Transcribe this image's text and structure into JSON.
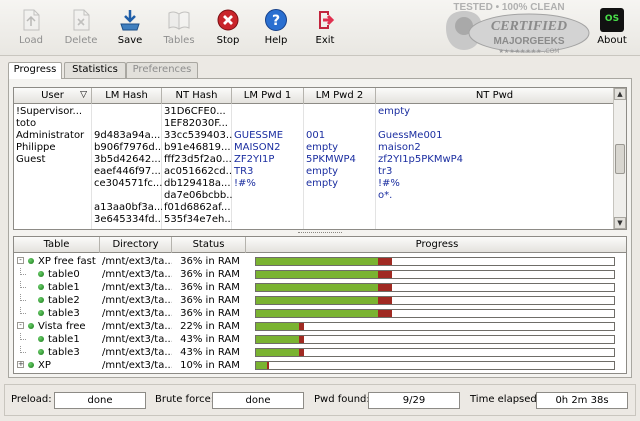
{
  "toolbar": {
    "load": "Load",
    "delete": "Delete",
    "save": "Save",
    "tables": "Tables",
    "stop": "Stop",
    "help": "Help",
    "exit": "Exit",
    "about": "About",
    "about_badge": "OS"
  },
  "watermark": {
    "top": "TESTED • 100% CLEAN",
    "middle": "CERTIFIED",
    "bottom": "MAJORGEEKS",
    "stars": "★★★★★★★★ .COM"
  },
  "tabs": [
    "Progress",
    "Statistics",
    "Preferences"
  ],
  "hash_table": {
    "columns": [
      "User",
      "LM Hash",
      "NT Hash",
      "LM Pwd 1",
      "LM Pwd 2",
      "NT Pwd"
    ],
    "sort_indicator": "▽",
    "rows": [
      [
        "!Supervisor...",
        "",
        "31D6CFE0...",
        "",
        "",
        "empty"
      ],
      [
        "toto",
        "",
        "1EF82030F...",
        "",
        "",
        ""
      ],
      [
        "Administrator",
        "9d483a94a...",
        "33cc539403...",
        "GUESSME",
        "001",
        "GuessMe001"
      ],
      [
        "Philippe",
        "b906f7976d...",
        "b91e46819...",
        "MAISON2",
        "empty",
        "maison2"
      ],
      [
        "Guest",
        "3b5d42642...",
        "fff23d5f2a0...",
        "ZF2YI1P",
        "5PKMWP4",
        "zf2YI1p5PKMwP4"
      ],
      [
        "",
        "eaef446f97...",
        "ac051662cd...",
        "TR3",
        "empty",
        "tr3"
      ],
      [
        "",
        "ce304571fc...",
        "db129418a...",
        "!#%",
        "empty",
        "!#%"
      ],
      [
        "",
        "",
        "da7e06bcbb...",
        "",
        "",
        "o*."
      ],
      [
        "",
        "a13aa0bf3a...",
        "f01d6862af...",
        "",
        "",
        ""
      ],
      [
        "",
        "3e645334fd...",
        "535f34e7eh...",
        "",
        "",
        ""
      ]
    ]
  },
  "table_list": {
    "columns": [
      "Table",
      "Directory",
      "Status",
      "Progress"
    ],
    "rows": [
      {
        "name": "XP free fast",
        "dir": "/mnt/ext3/ta...",
        "status": "36% in RAM",
        "level": 0,
        "expander": "-",
        "progress": 0.34,
        "tip": 0.04
      },
      {
        "name": "table0",
        "dir": "/mnt/ext3/ta...",
        "status": "36% in RAM",
        "level": 1,
        "expander": "",
        "progress": 0.34,
        "tip": 0.04
      },
      {
        "name": "table1",
        "dir": "/mnt/ext3/ta...",
        "status": "36% in RAM",
        "level": 1,
        "expander": "",
        "progress": 0.34,
        "tip": 0.04
      },
      {
        "name": "table2",
        "dir": "/mnt/ext3/ta...",
        "status": "36% in RAM",
        "level": 1,
        "expander": "",
        "progress": 0.34,
        "tip": 0.04
      },
      {
        "name": "table3",
        "dir": "/mnt/ext3/ta...",
        "status": "36% in RAM",
        "level": 1,
        "expander": "",
        "progress": 0.34,
        "tip": 0.04
      },
      {
        "name": "Vista free",
        "dir": "/mnt/ext3/ta...",
        "status": "22% in RAM",
        "level": 0,
        "expander": "-",
        "progress": 0.12,
        "tip": 0.015
      },
      {
        "name": "table1",
        "dir": "/mnt/ext3/ta...",
        "status": "43% in RAM",
        "level": 1,
        "expander": "",
        "progress": 0.12,
        "tip": 0.015
      },
      {
        "name": "table3",
        "dir": "/mnt/ext3/ta...",
        "status": "43% in RAM",
        "level": 1,
        "expander": "",
        "progress": 0.12,
        "tip": 0.015
      },
      {
        "name": "XP",
        "dir": "/mnt/ext3/ta...",
        "status": "10% in RAM",
        "level": 0,
        "expander": "+",
        "progress": 0.03,
        "tip": 0.006
      }
    ]
  },
  "status": {
    "preload_label": "Preload:",
    "preload_value": "done",
    "brute_label": "Brute force:",
    "brute_value": "done",
    "pwd_label": "Pwd found:",
    "pwd_value": "9/29",
    "time_label": "Time elapsed:",
    "time_value": "0h 2m 38s"
  },
  "colors": {
    "progress_fill": "#7ab331",
    "progress_tip": "#a02a22",
    "password_text": "#1b2ea0"
  }
}
